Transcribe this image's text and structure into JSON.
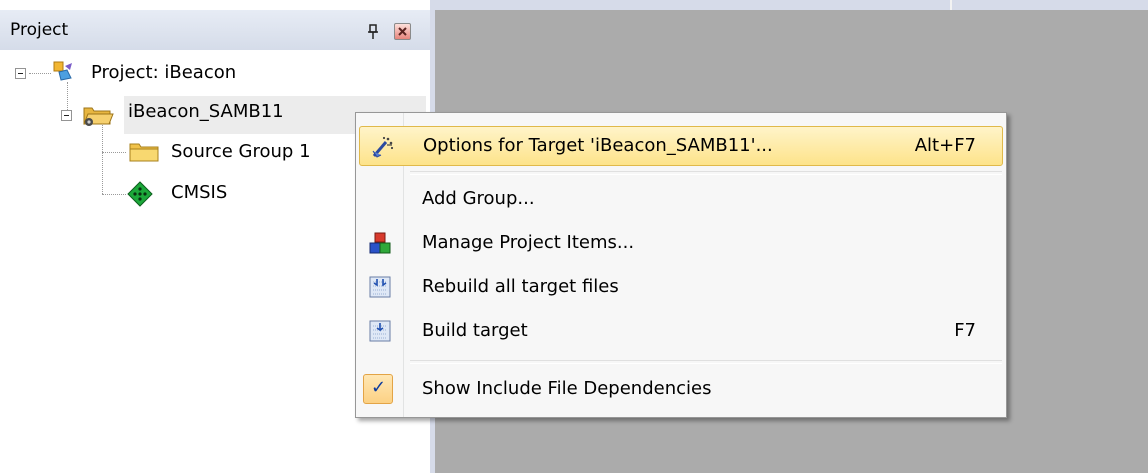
{
  "panel": {
    "title": "Project",
    "pin_icon": "pin-icon",
    "close_icon": "close-icon"
  },
  "tree": {
    "root_label": "Project: iBeacon",
    "target_label": "iBeacon_SAMB11",
    "children": [
      {
        "label": "Source Group 1",
        "icon": "folder-icon"
      },
      {
        "label": "CMSIS",
        "icon": "cmsis-component-icon"
      }
    ]
  },
  "context_menu": {
    "items": [
      {
        "label": "Options for Target 'iBeacon_SAMB11'...",
        "shortcut": "Alt+F7",
        "icon": "magic-wand-icon",
        "highlighted": true
      },
      {
        "label": "Add Group...",
        "shortcut": "",
        "icon": ""
      },
      {
        "label": "Manage Project Items...",
        "shortcut": "",
        "icon": "colored-blocks-icon"
      },
      {
        "label": "Rebuild all target files",
        "shortcut": "",
        "icon": "rebuild-icon"
      },
      {
        "label": "Build target",
        "shortcut": "F7",
        "icon": "build-icon"
      },
      {
        "label": "Show Include File Dependencies",
        "shortcut": "",
        "icon": "check-icon",
        "checked": true
      }
    ]
  },
  "colors": {
    "workspace_bg": "#ababab",
    "menu_highlight": "#fde38a",
    "checkbox_bg": "#fcd184"
  }
}
